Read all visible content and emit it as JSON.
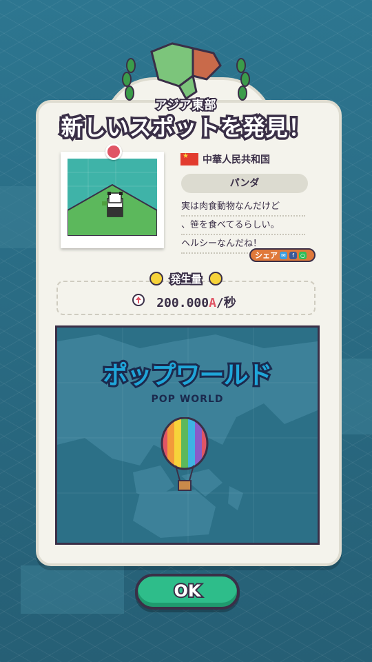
{
  "popup": {
    "region": "アジア東部",
    "headline": "新しいスポットを発見！"
  },
  "spot": {
    "country": "中華人民共和国",
    "name": "パンダ",
    "description": [
      "実は肉食動物なんだけど",
      "、笹を食べてるらしい。",
      "ヘルシーなんだね！"
    ],
    "share_label": "シェア"
  },
  "production": {
    "title": "発生量",
    "value": "200.000",
    "unit": "A",
    "per": "/秒"
  },
  "game_logo": {
    "jp": "ポップワールド",
    "en": "POP WORLD"
  },
  "ok_button": "OK",
  "colors": {
    "ok_green": "#2ebd8a",
    "accent_red": "#e05565",
    "ink": "#3a2f47",
    "smile_yellow": "#f7d33a"
  }
}
